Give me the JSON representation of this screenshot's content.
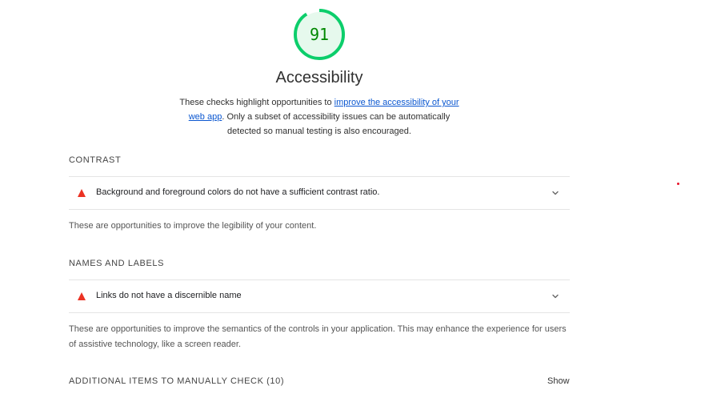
{
  "score": {
    "value": "91",
    "fraction": 0.91,
    "color": "#0cce6b"
  },
  "category": {
    "title": "Accessibility",
    "description_pre": "These checks highlight opportunities to ",
    "description_link": "improve the accessibility of your web app",
    "description_post": ". Only a subset of accessibility issues can be automatically detected so manual testing is also encouraged."
  },
  "groups": [
    {
      "header": "CONTRAST",
      "audit": {
        "title": "Background and foreground colors do not have a sufficient contrast ratio.",
        "icon": "fail-triangle-icon"
      },
      "description": "These are opportunities to improve the legibility of your content."
    },
    {
      "header": "NAMES AND LABELS",
      "audit": {
        "title": "Links do not have a discernible name",
        "icon": "fail-triangle-icon"
      },
      "description": "These are opportunities to improve the semantics of the controls in your application. This may enhance the experience for users of assistive technology, like a screen reader."
    }
  ],
  "manual": {
    "header": "ADDITIONAL ITEMS TO MANUALLY CHECK",
    "count": "(10)",
    "toggle": "Show"
  },
  "colors": {
    "fail": "#eb3223",
    "link": "#0b57d0",
    "pass": "#0cce6b"
  }
}
